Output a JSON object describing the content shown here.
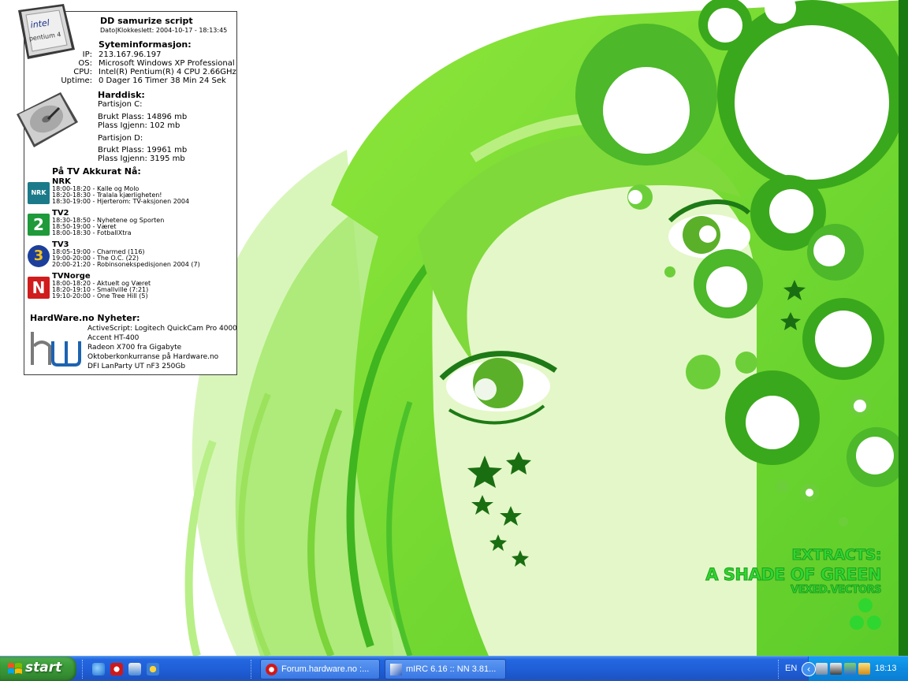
{
  "wallpaper": {
    "line1": "EXTRACTS:",
    "line2": "A SHADE OF GREEN",
    "line3": "VEXED.VECTORS"
  },
  "panel": {
    "title": "DD samurize script",
    "datetime": "Dato|Klokkeslett: 2004-10-17 - 18:13:45",
    "cpu_logo_brand": "intel",
    "cpu_logo_model": "pentium 4",
    "sysinfo": {
      "heading": "Syteminformasjon:",
      "rows": [
        {
          "label": "IP:",
          "value": "213.167.96.197"
        },
        {
          "label": "OS:",
          "value": "Microsoft Windows XP Professional"
        },
        {
          "label": "CPU:",
          "value": "Intel(R) Pentium(R) 4 CPU 2.66GHz"
        },
        {
          "label": "Uptime:",
          "value": "0 Dager 16 Timer 38 Min 24 Sek"
        }
      ]
    },
    "harddisk": {
      "heading": "Harddisk:",
      "partitions": [
        {
          "name": "Partisjon C:",
          "used": "Brukt Plass: 14896 mb",
          "free": "Plass Igjenn: 102 mb"
        },
        {
          "name": "Partisjon D:",
          "used": "Brukt Plass: 19961 mb",
          "free": "Plass Igjenn: 3195 mb"
        }
      ]
    },
    "tv": {
      "heading": "På TV Akkurat Nå:",
      "channels": [
        {
          "name": "NRK",
          "logo": "NRK",
          "color": "#1a7a8a",
          "shows": [
            "18:00-18:20 - Kalle og Molo",
            "18:20-18:30 - Tralala kjærligheten!",
            "18:30-19:00 - Hjerterom: TV-aksjonen 2004"
          ]
        },
        {
          "name": "TV2",
          "logo": "2",
          "color": "#1e9a3a",
          "shows": [
            "18:30-18:50 - Nyhetene og Sporten",
            "18:50-19:00 - Været",
            "18:00-18:30 - FotballXtra"
          ]
        },
        {
          "name": "TV3",
          "logo": "3",
          "color": "#1c3f9c",
          "shows": [
            "18:05-19:00 - Charmed (116)",
            "19:00-20:00 - The O.C. (22)",
            "20:00-21:20 - Robinsonekspedisjonen 2004 (7)"
          ]
        },
        {
          "name": "TVNorge",
          "logo": "N",
          "color": "#d01c1c",
          "shows": [
            "18:00-18:20 - Aktuelt og Været",
            "18:20-19:10 - Smallville (7:21)",
            "19:10-20:00 - One Tree Hill (5)"
          ]
        }
      ]
    },
    "news": {
      "heading": "HardWare.no Nyheter:",
      "items": [
        "ActiveScript: Logitech QuickCam Pro 4000",
        "Accent HT-400",
        "Radeon X700 fra Gigabyte",
        "Oktoberkonkurranse på Hardware.no",
        "DFI LanParty UT nF3 250Gb"
      ]
    }
  },
  "taskbar": {
    "start_label": "start",
    "quicklaunch": [
      "ie-icon",
      "opera-icon",
      "outlook-icon",
      "media-player-icon"
    ],
    "tasks": [
      {
        "label": "Forum.hardware.no :...",
        "icon": "opera-icon"
      },
      {
        "label": "mIRC 6.16 :: NN 3.81...",
        "icon": "mirc-icon"
      }
    ],
    "language": "EN",
    "clock": "18:13"
  }
}
